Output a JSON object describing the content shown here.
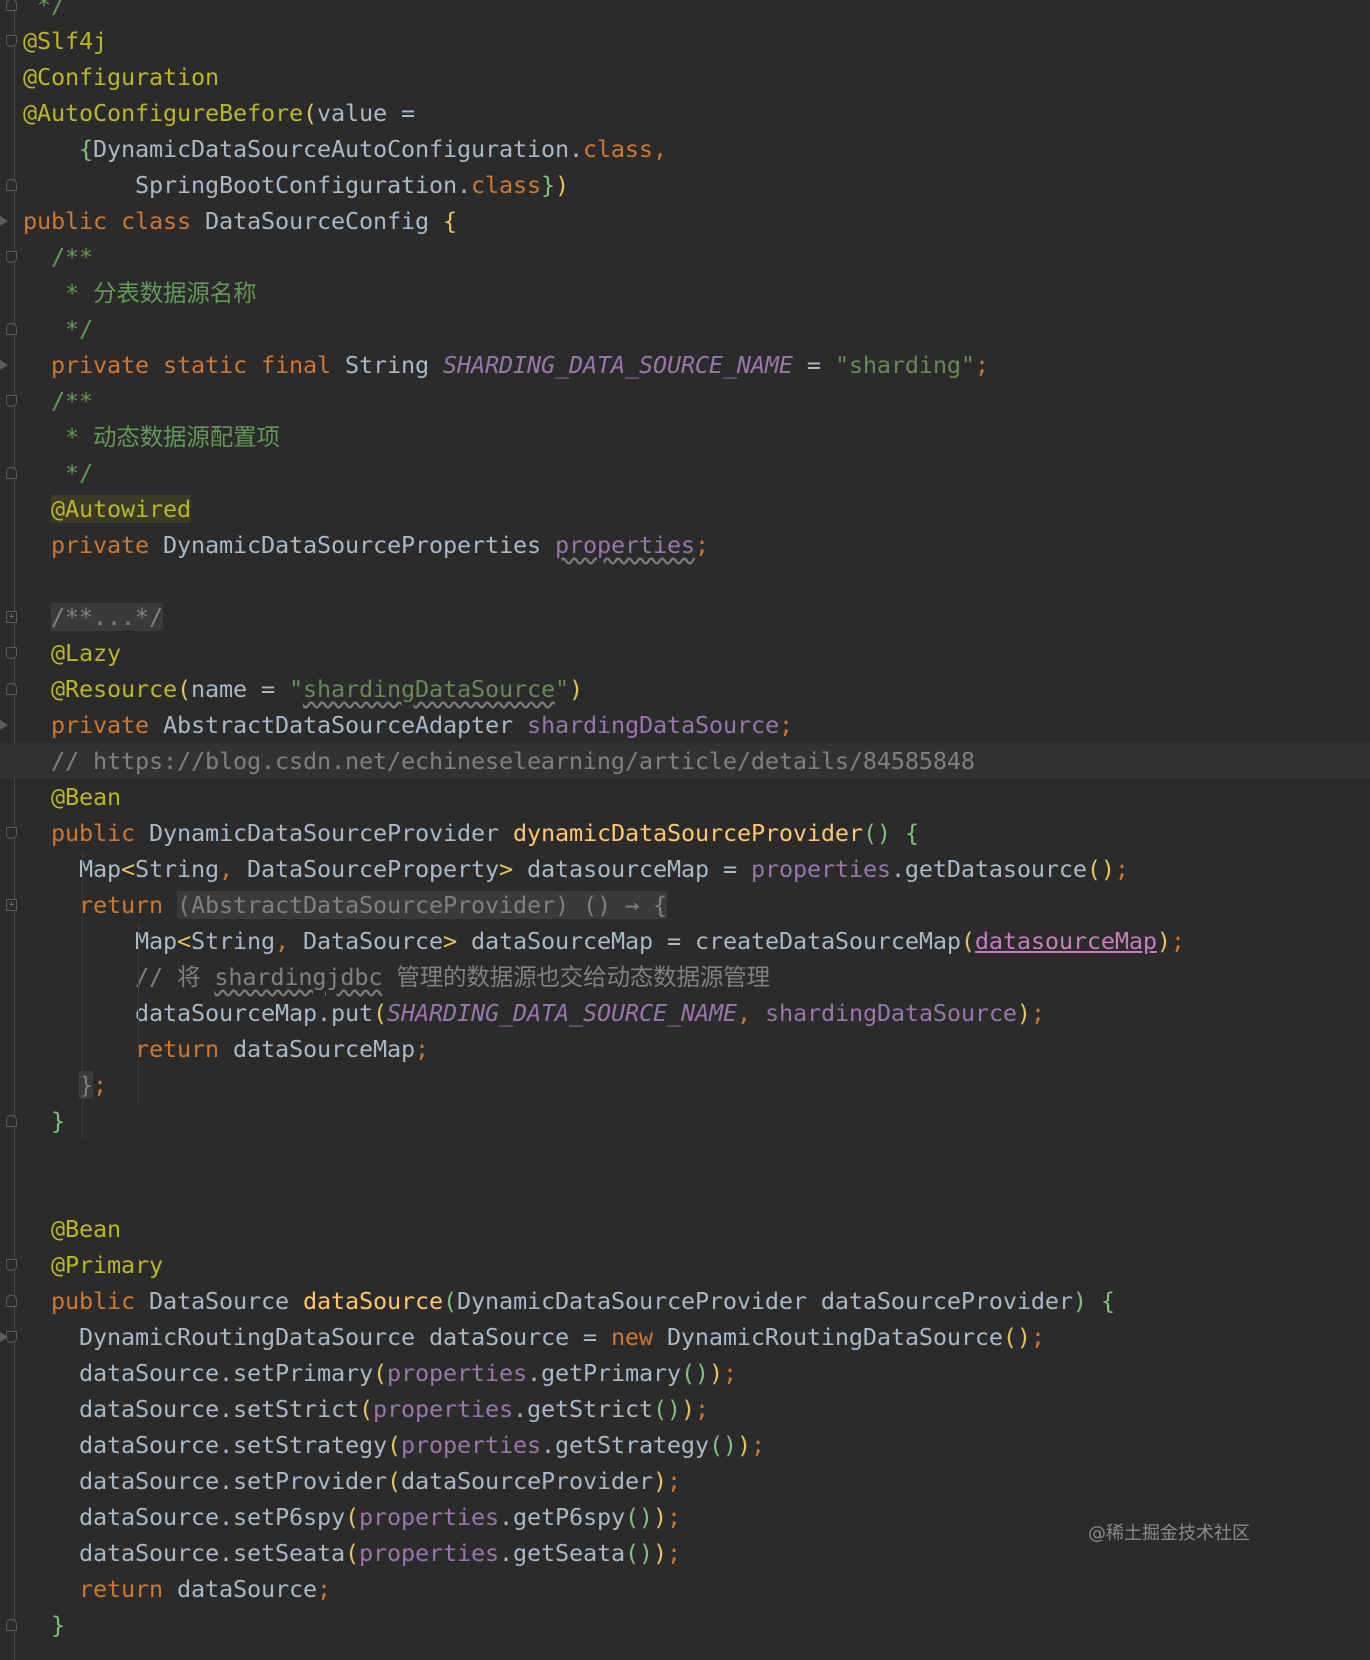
{
  "watermark": "@稀土掘金技术社区",
  "lines": [
    {
      "indent": 1,
      "tokens": [
        {
          "t": "*/",
          "c": "d"
        }
      ]
    },
    {
      "indent": 0,
      "tokens": [
        {
          "t": "@Slf4j",
          "c": "a"
        }
      ]
    },
    {
      "indent": 0,
      "tokens": [
        {
          "t": "@Configuration",
          "c": "a"
        }
      ]
    },
    {
      "indent": 0,
      "tokens": [
        {
          "t": "@AutoConfigureBefore",
          "c": "a"
        },
        {
          "t": "(",
          "c": "p1"
        },
        {
          "t": "value",
          "c": "pn"
        },
        {
          "t": " = ",
          "c": "pn"
        }
      ]
    },
    {
      "indent": 4,
      "tokens": [
        {
          "t": "{",
          "c": "p2"
        },
        {
          "t": "DynamicDataSourceAutoConfiguration.",
          "c": "pn"
        },
        {
          "t": "class",
          "c": "k"
        },
        {
          "t": ",",
          "c": "k"
        }
      ]
    },
    {
      "indent": 8,
      "tokens": [
        {
          "t": "SpringBootConfiguration.",
          "c": "pn"
        },
        {
          "t": "class",
          "c": "k"
        },
        {
          "t": "}",
          "c": "p2"
        },
        {
          "t": ")",
          "c": "p1"
        }
      ]
    },
    {
      "indent": 0,
      "tokens": [
        {
          "t": "public class ",
          "c": "k"
        },
        {
          "t": "DataSourceConfig ",
          "c": "pn"
        },
        {
          "t": "{",
          "c": "p1"
        }
      ]
    },
    {
      "indent": 2,
      "tokens": [
        {
          "t": "/**",
          "c": "d"
        }
      ]
    },
    {
      "indent": 2,
      "tokens": [
        {
          "t": " * 分表数据源名称",
          "c": "d"
        }
      ]
    },
    {
      "indent": 2,
      "tokens": [
        {
          "t": " */",
          "c": "d"
        }
      ]
    },
    {
      "indent": 2,
      "tokens": [
        {
          "t": "private static final ",
          "c": "k"
        },
        {
          "t": "String ",
          "c": "pn"
        },
        {
          "t": "SHARDING_DATA_SOURCE_NAME",
          "c": "sf"
        },
        {
          "t": " = ",
          "c": "pn"
        },
        {
          "t": "\"sharding\"",
          "c": "s"
        },
        {
          "t": ";",
          "c": "k"
        }
      ]
    },
    {
      "indent": 2,
      "tokens": [
        {
          "t": "/**",
          "c": "d"
        }
      ]
    },
    {
      "indent": 2,
      "tokens": [
        {
          "t": " * 动态数据源配置项",
          "c": "d"
        }
      ]
    },
    {
      "indent": 2,
      "tokens": [
        {
          "t": " */",
          "c": "d"
        }
      ]
    },
    {
      "indent": 2,
      "tokens": [
        {
          "t": "@Autowired",
          "c": "a hl"
        }
      ]
    },
    {
      "indent": 2,
      "tokens": [
        {
          "t": "private ",
          "c": "k"
        },
        {
          "t": "DynamicDataSourceProperties ",
          "c": "pn"
        },
        {
          "t": "properties",
          "c": "f w"
        },
        {
          "t": ";",
          "c": "k"
        }
      ]
    },
    {
      "indent": 0,
      "tokens": []
    },
    {
      "indent": 2,
      "tokens": [
        {
          "t": "/**...*/",
          "c": "c fr"
        }
      ]
    },
    {
      "indent": 2,
      "tokens": [
        {
          "t": "@Lazy",
          "c": "a"
        }
      ]
    },
    {
      "indent": 2,
      "tokens": [
        {
          "t": "@Resource",
          "c": "a"
        },
        {
          "t": "(",
          "c": "p1"
        },
        {
          "t": "name",
          "c": "pn"
        },
        {
          "t": " = ",
          "c": "pn"
        },
        {
          "t": "\"",
          "c": "s"
        },
        {
          "t": "shardingDataSource",
          "c": "s w"
        },
        {
          "t": "\"",
          "c": "s"
        },
        {
          "t": ")",
          "c": "p1"
        }
      ]
    },
    {
      "indent": 2,
      "tokens": [
        {
          "t": "private ",
          "c": "k"
        },
        {
          "t": "AbstractDataSourceAdapter ",
          "c": "pn"
        },
        {
          "t": "shardingDataSource",
          "c": "f"
        },
        {
          "t": ";",
          "c": "k"
        }
      ]
    },
    {
      "indent": 2,
      "current": true,
      "tokens": [
        {
          "t": "// https://blog.csdn.net/echineselearning/article/details/84585848",
          "c": "c"
        }
      ]
    },
    {
      "indent": 2,
      "tokens": [
        {
          "t": "@Bean",
          "c": "a"
        }
      ]
    },
    {
      "indent": 2,
      "tokens": [
        {
          "t": "public ",
          "c": "k"
        },
        {
          "t": "DynamicDataSourceProvider ",
          "c": "pn"
        },
        {
          "t": "dynamicDataSourceProvider",
          "c": "m"
        },
        {
          "t": "() ",
          "c": "p2"
        },
        {
          "t": "{",
          "c": "p2"
        }
      ]
    },
    {
      "indent": 4,
      "tokens": [
        {
          "t": "Map",
          "c": "pn"
        },
        {
          "t": "<",
          "c": "p1"
        },
        {
          "t": "String",
          "c": "pn"
        },
        {
          "t": ", ",
          "c": "k"
        },
        {
          "t": "DataSourceProperty",
          "c": "pn"
        },
        {
          "t": ">",
          "c": "p1"
        },
        {
          "t": " datasourceMap = ",
          "c": "pn"
        },
        {
          "t": "properties",
          "c": "f"
        },
        {
          "t": ".getDatasource",
          "c": "pn"
        },
        {
          "t": "()",
          "c": "p1"
        },
        {
          "t": ";",
          "c": "k"
        }
      ]
    },
    {
      "indent": 4,
      "tokens": [
        {
          "t": "return ",
          "c": "k"
        },
        {
          "t": "(AbstractDataSourceProvider) () → {",
          "c": "c fr"
        }
      ]
    },
    {
      "indent": 8,
      "tokens": [
        {
          "t": "Map",
          "c": "pn"
        },
        {
          "t": "<",
          "c": "p1"
        },
        {
          "t": "String",
          "c": "pn"
        },
        {
          "t": ", ",
          "c": "k"
        },
        {
          "t": "DataSource",
          "c": "pn"
        },
        {
          "t": ">",
          "c": "p1"
        },
        {
          "t": " dataSourceMap = createDataSourceMap",
          "c": "pn"
        },
        {
          "t": "(",
          "c": "p1"
        },
        {
          "t": "datasourceMap",
          "c": "p3 u"
        },
        {
          "t": ")",
          "c": "p1"
        },
        {
          "t": ";",
          "c": "k"
        }
      ]
    },
    {
      "indent": 8,
      "tokens": [
        {
          "t": "// 将 ",
          "c": "c"
        },
        {
          "t": "shardingjdbc",
          "c": "c w"
        },
        {
          "t": " 管理的数据源也交给动态数据源管理",
          "c": "c"
        }
      ]
    },
    {
      "indent": 8,
      "tokens": [
        {
          "t": "dataSourceMap.put",
          "c": "pn"
        },
        {
          "t": "(",
          "c": "p1"
        },
        {
          "t": "SHARDING_DATA_SOURCE_NAME",
          "c": "sf"
        },
        {
          "t": ", ",
          "c": "k"
        },
        {
          "t": "shardingDataSource",
          "c": "f"
        },
        {
          "t": ")",
          "c": "p1"
        },
        {
          "t": ";",
          "c": "k"
        }
      ]
    },
    {
      "indent": 8,
      "tokens": [
        {
          "t": "return ",
          "c": "k"
        },
        {
          "t": "dataSourceMap",
          "c": "pn"
        },
        {
          "t": ";",
          "c": "k"
        }
      ]
    },
    {
      "indent": 4,
      "tokens": [
        {
          "t": "}",
          "c": "c fr"
        },
        {
          "t": ";",
          "c": "k"
        }
      ]
    },
    {
      "indent": 2,
      "tokens": [
        {
          "t": "}",
          "c": "p2"
        }
      ]
    },
    {
      "indent": 0,
      "tokens": []
    },
    {
      "indent": 0,
      "tokens": []
    },
    {
      "indent": 2,
      "tokens": [
        {
          "t": "@Bean",
          "c": "a"
        }
      ]
    },
    {
      "indent": 2,
      "tokens": [
        {
          "t": "@Primary",
          "c": "a"
        }
      ]
    },
    {
      "indent": 2,
      "tokens": [
        {
          "t": "public ",
          "c": "k"
        },
        {
          "t": "DataSource ",
          "c": "pn"
        },
        {
          "t": "dataSource",
          "c": "m"
        },
        {
          "t": "(",
          "c": "p2"
        },
        {
          "t": "DynamicDataSourceProvider dataSourceProvider",
          "c": "pn"
        },
        {
          "t": ") ",
          "c": "p2"
        },
        {
          "t": "{",
          "c": "p2"
        }
      ]
    },
    {
      "indent": 4,
      "tokens": [
        {
          "t": "DynamicRoutingDataSource dataSource = ",
          "c": "pn"
        },
        {
          "t": "new ",
          "c": "k"
        },
        {
          "t": "DynamicRoutingDataSource",
          "c": "pn"
        },
        {
          "t": "()",
          "c": "p1"
        },
        {
          "t": ";",
          "c": "k"
        }
      ]
    },
    {
      "indent": 4,
      "tokens": [
        {
          "t": "dataSource.setPrimary",
          "c": "pn"
        },
        {
          "t": "(",
          "c": "p1"
        },
        {
          "t": "properties",
          "c": "f"
        },
        {
          "t": ".getPrimary",
          "c": "pn"
        },
        {
          "t": "()",
          "c": "p2"
        },
        {
          "t": ")",
          "c": "p1"
        },
        {
          "t": ";",
          "c": "k"
        }
      ]
    },
    {
      "indent": 4,
      "tokens": [
        {
          "t": "dataSource.setStrict",
          "c": "pn"
        },
        {
          "t": "(",
          "c": "p1"
        },
        {
          "t": "properties",
          "c": "f"
        },
        {
          "t": ".getStrict",
          "c": "pn"
        },
        {
          "t": "()",
          "c": "p2"
        },
        {
          "t": ")",
          "c": "p1"
        },
        {
          "t": ";",
          "c": "k"
        }
      ]
    },
    {
      "indent": 4,
      "tokens": [
        {
          "t": "dataSource.setStrategy",
          "c": "pn"
        },
        {
          "t": "(",
          "c": "p1"
        },
        {
          "t": "properties",
          "c": "f"
        },
        {
          "t": ".getStrategy",
          "c": "pn"
        },
        {
          "t": "()",
          "c": "p2"
        },
        {
          "t": ")",
          "c": "p1"
        },
        {
          "t": ";",
          "c": "k"
        }
      ]
    },
    {
      "indent": 4,
      "tokens": [
        {
          "t": "dataSource.setProvider",
          "c": "pn"
        },
        {
          "t": "(",
          "c": "p1"
        },
        {
          "t": "dataSourceProvider",
          "c": "pn"
        },
        {
          "t": ")",
          "c": "p1"
        },
        {
          "t": ";",
          "c": "k"
        }
      ]
    },
    {
      "indent": 4,
      "tokens": [
        {
          "t": "dataSource.setP6spy",
          "c": "pn"
        },
        {
          "t": "(",
          "c": "p1"
        },
        {
          "t": "properties",
          "c": "f"
        },
        {
          "t": ".getP6spy",
          "c": "pn"
        },
        {
          "t": "()",
          "c": "p2"
        },
        {
          "t": ")",
          "c": "p1"
        },
        {
          "t": ";",
          "c": "k"
        }
      ]
    },
    {
      "indent": 4,
      "tokens": [
        {
          "t": "dataSource.setSeata",
          "c": "pn"
        },
        {
          "t": "(",
          "c": "p1"
        },
        {
          "t": "properties",
          "c": "f"
        },
        {
          "t": ".getSeata",
          "c": "pn"
        },
        {
          "t": "()",
          "c": "p2"
        },
        {
          "t": ")",
          "c": "p1"
        },
        {
          "t": ";",
          "c": "k"
        }
      ]
    },
    {
      "indent": 4,
      "tokens": [
        {
          "t": "return ",
          "c": "k"
        },
        {
          "t": "dataSource",
          "c": "pn"
        },
        {
          "t": ";",
          "c": "k"
        }
      ]
    },
    {
      "indent": 2,
      "tokens": [
        {
          "t": "}",
          "c": "p2"
        }
      ]
    }
  ]
}
